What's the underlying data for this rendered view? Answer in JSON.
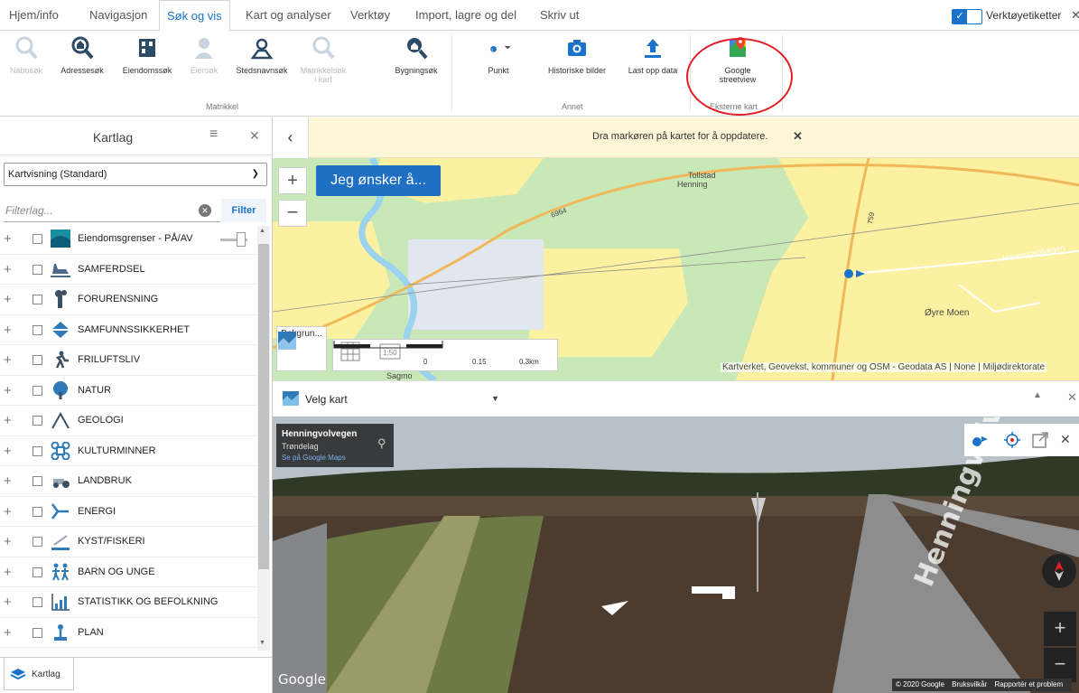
{
  "tabs": [
    {
      "label": "Hjem/info"
    },
    {
      "label": "Navigasjon"
    },
    {
      "label": "Søk og vis",
      "active": true
    },
    {
      "label": "Kart og analyser"
    },
    {
      "label": "Verktøy"
    },
    {
      "label": "Import, lagre og del"
    },
    {
      "label": "Skriv ut"
    }
  ],
  "toolbar_toggle": {
    "label": "Verktøyetiketter",
    "checked": true
  },
  "ribbon": {
    "matrikkel_buttons": [
      {
        "label": "Nabosøk",
        "enabled": false,
        "icon": "neighbor-search-icon"
      },
      {
        "label": "Adressesøk",
        "enabled": true,
        "icon": "address-search-icon"
      },
      {
        "label": "Eiendomssøk",
        "enabled": true,
        "icon": "property-search-icon"
      },
      {
        "label": "Eiersøk",
        "enabled": false,
        "icon": "owner-search-icon"
      },
      {
        "label": "Stedsnavnsøk",
        "enabled": true,
        "icon": "place-name-search-icon"
      },
      {
        "label": "Matrikkelsøk i kart",
        "enabled": false,
        "icon": "cadastre-map-search-icon"
      },
      {
        "label": "Bygningsøk",
        "enabled": true,
        "icon": "building-search-icon"
      }
    ],
    "matrikkel_label": "Matrikkel",
    "annet_buttons": [
      {
        "label": "Punkt",
        "icon": "point-icon"
      },
      {
        "label": "Historiske bilder",
        "icon": "camera-icon"
      },
      {
        "label": "Last opp data",
        "icon": "upload-icon"
      }
    ],
    "annet_label": "Annet",
    "external_buttons": [
      {
        "label": "Google streetview",
        "icon": "google-maps-icon"
      }
    ],
    "external_label": "Eksterne kart"
  },
  "left_panel": {
    "title": "Kartlag",
    "view_select": "Kartvisning (Standard)",
    "filter_placeholder": "Filterlag...",
    "filter_button": "Filter",
    "layers": [
      {
        "name": "Eiendomsgrenser - PÅ/AV",
        "icon": "property-boundaries-icon"
      },
      {
        "name": "SAMFERDSEL",
        "icon": "transport-icon"
      },
      {
        "name": "FORURENSNING",
        "icon": "pollution-icon"
      },
      {
        "name": "SAMFUNNSSIKKERHET",
        "icon": "public-safety-icon"
      },
      {
        "name": "FRILUFTSLIV",
        "icon": "outdoor-life-icon"
      },
      {
        "name": "NATUR",
        "icon": "nature-icon"
      },
      {
        "name": "GEOLOGI",
        "icon": "geology-icon"
      },
      {
        "name": "KULTURMINNER",
        "icon": "cultural-heritage-icon"
      },
      {
        "name": "LANDBRUK",
        "icon": "agriculture-icon"
      },
      {
        "name": "ENERGI",
        "icon": "energy-icon"
      },
      {
        "name": "KYST/FISKERI",
        "icon": "coast-fishery-icon"
      },
      {
        "name": "BARN OG UNGE",
        "icon": "children-icon"
      },
      {
        "name": "STATISTIKK OG BEFOLKNING",
        "icon": "statistics-icon"
      },
      {
        "name": "PLAN",
        "icon": "plan-icon"
      }
    ],
    "footer_tab": "Kartlag"
  },
  "notice": {
    "text": "Dra markøren på kartet for å oppdatere."
  },
  "map": {
    "wish_button": "Jeg ønsker å...",
    "background_button": "Bakgrun...",
    "scale_labels": [
      "0",
      "0.15",
      "0.3km"
    ],
    "attribution": "Kartverket, Geovekst, kommuner og OSM - Geodata AS | None | Miljødirektorate",
    "places": [
      "Tollstad",
      "Henning",
      "Øyre Moen",
      "Henningvolvegen",
      "Sagmo"
    ],
    "road_numbers": [
      "6954",
      "759"
    ]
  },
  "map_picker": {
    "label": "Velg kart"
  },
  "streetview": {
    "street": "Henningvolvegen",
    "region": "Trøndelag",
    "link": "Se på Google Maps",
    "logo": "Google",
    "footer": [
      "© 2020 Google",
      "Bruksvilkår",
      "Rapportér et problem"
    ],
    "road_text": "Henningvolv"
  },
  "colors": {
    "accent": "#1a73c8",
    "notice_bg": "#fdf7d8",
    "highlight": "#e41e26",
    "map_green": "#c9e8b8",
    "map_yellow": "#fbf1a0"
  }
}
